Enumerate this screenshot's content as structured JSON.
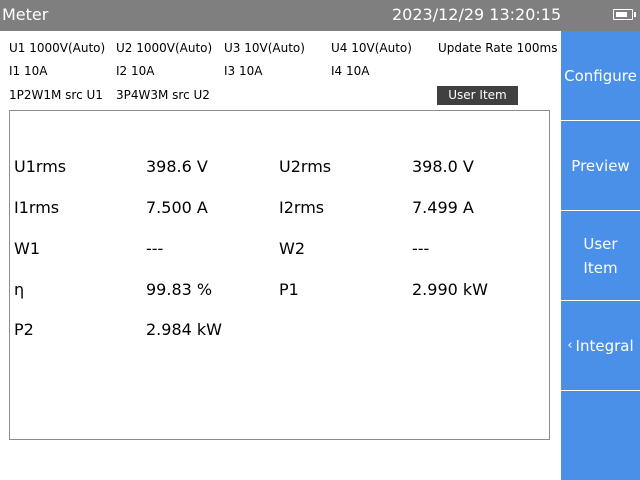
{
  "window": {
    "title": "Meter",
    "datetime": "2023/12/29 13:20:15"
  },
  "channels": {
    "u1": "U1 1000V(Auto)",
    "u2": "U2 1000V(Auto)",
    "u3": "U3 10V(Auto)",
    "u4": "U4 10V(Auto)",
    "update_rate": "Update Rate 100ms",
    "i1": "I1 10A",
    "i2": "I2 10A",
    "i3": "I3 10A",
    "i4": "I4 10A",
    "wiring1": "1P2W1M src U1",
    "wiring2": "3P4W3M src U2"
  },
  "user_item_label": "User Item",
  "measurements": [
    {
      "label": "U1rms",
      "value": "398.6 V"
    },
    {
      "label": "U2rms",
      "value": "398.0 V"
    },
    {
      "label": "I1rms",
      "value": "7.500 A"
    },
    {
      "label": "I2rms",
      "value": "7.499 A"
    },
    {
      "label": "W1",
      "value": "---"
    },
    {
      "label": "W2",
      "value": "---"
    },
    {
      "label": "η",
      "value": "99.83 %"
    },
    {
      "label": "P1",
      "value": "2.990 kW"
    },
    {
      "label": "P2",
      "value": "2.984 kW"
    }
  ],
  "sidebar": [
    {
      "label": "Configure"
    },
    {
      "label": "Preview"
    },
    {
      "label": "User\nItem"
    },
    {
      "label": "Integral",
      "icon": "chevron-left-icon"
    },
    {
      "label": ""
    }
  ],
  "colors": {
    "titlebar": "#7f7f7f",
    "sidebar": "#4a90e8",
    "user_item_bg": "#404040"
  }
}
